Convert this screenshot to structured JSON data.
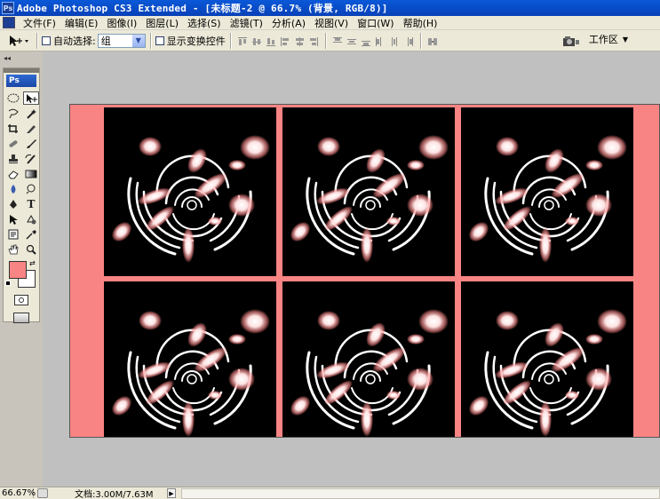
{
  "window": {
    "title": "Adobe Photoshop CS3 Extended - [未标题-2 @ 66.7% (背景, RGB/8)]",
    "logo_text": "Ps"
  },
  "menu": [
    "文件(F)",
    "编辑(E)",
    "图像(I)",
    "图层(L)",
    "选择(S)",
    "滤镜(T)",
    "分析(A)",
    "视图(V)",
    "窗口(W)",
    "帮助(H)"
  ],
  "options_bar": {
    "auto_select_label": "自动选择:",
    "auto_select_value": "组",
    "show_transform_label": "显示变换控件",
    "workspace_label": "工作区"
  },
  "toolbox": {
    "badge": "Ps",
    "foreground_color": "#f98484",
    "background_color": "#ffffff"
  },
  "document": {
    "background_color": "#f98484",
    "tile_background": "#000000",
    "tile_rows": 2,
    "tile_columns": 3
  },
  "status_bar": {
    "zoom": "66.67%",
    "doc_info": "文档:3.00M/7.63M"
  }
}
